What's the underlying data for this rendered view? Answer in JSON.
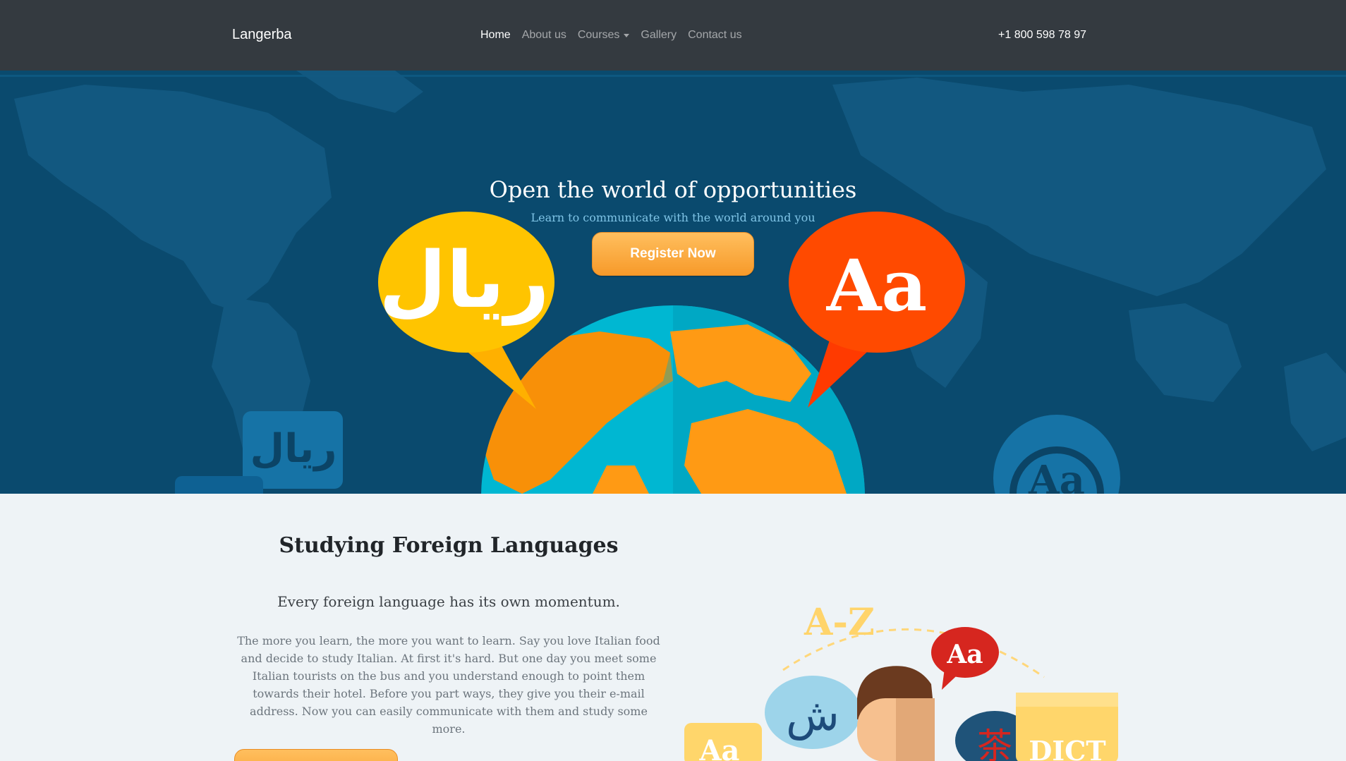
{
  "navbar": {
    "brand": "Langerba",
    "items": [
      {
        "label": "Home",
        "active": true
      },
      {
        "label": "About us"
      },
      {
        "label": "Courses",
        "dropdown": true
      },
      {
        "label": "Gallery"
      },
      {
        "label": "Contact us"
      }
    ],
    "phone": "+1 800 598 78 97"
  },
  "hero": {
    "title": "Open the world of opportunities",
    "subtitle": "Learn to communicate with the world around you",
    "register_label": "Register Now",
    "bubble_left_text": "ريال",
    "bubble_right_text": "Aa",
    "small_left_text": "ريال",
    "small_right_text": "Aa"
  },
  "section": {
    "title": "Studying Foreign Languages",
    "lead": "Every foreign language has its own momentum.",
    "text": "The more you learn, the more you want to learn. Say you love Italian food and decide to study Italian. At first it's hard. But one day you meet some Italian tourists on the bus and you understand enough to point them towards their hotel. Before you part ways, they give you their e-mail address. Now you can easily communicate with them and study some more."
  },
  "illustration": {
    "az_text": "A-Z",
    "aa_text": "Aa",
    "arabic_text": "ش",
    "chinese_text": "茶",
    "dict_text": "DICT",
    "aa_small_text": "Aa"
  },
  "colors": {
    "navbar_bg": "#343a40",
    "hero_bg": "#0a4a6e",
    "accent_orange": "#f79a2a",
    "bubble_yellow": "#ffc400",
    "bubble_red": "#ff4a00",
    "globe_ocean": "#00b7d2",
    "globe_land": "#ff9a14"
  }
}
